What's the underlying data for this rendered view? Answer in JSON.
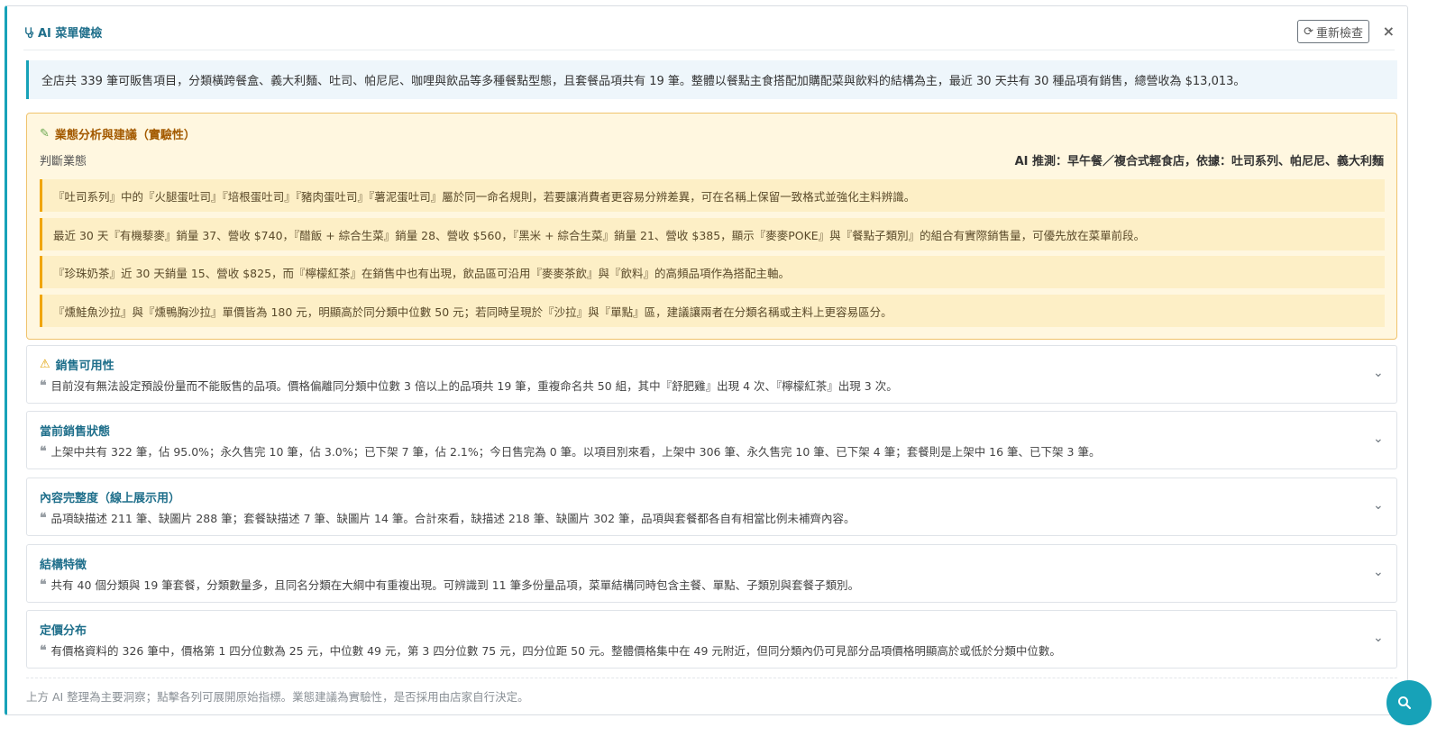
{
  "header": {
    "title": "AI 菜單健檢",
    "recheck_label": "重新檢查",
    "close_label": "×"
  },
  "summary": "全店共 339 筆可販售項目，分類橫跨餐盒、義大利麵、吐司、帕尼尼、咖哩與飲品等多種餐點型態，且套餐品項共有 19 筆。整體以餐點主食搭配加購配菜與飲料的結構為主，最近 30 天共有 30 種品項有銷售，總營收為 $13,013。",
  "business": {
    "title": "業態分析與建議（實驗性）",
    "judge_label": "判斷業態",
    "judge_value": "AI 推測：早午餐／複合式輕食店，依據：吐司系列、帕尼尼、義大利麵",
    "suggestions": [
      "『吐司系列』中的『火腿蛋吐司』『培根蛋吐司』『豬肉蛋吐司』『薯泥蛋吐司』屬於同一命名規則，若要讓消費者更容易分辨差異，可在名稱上保留一致格式並強化主料辨識。",
      "最近 30 天『有機藜麥』銷量 37、營收 $740，『醋飯 + 綜合生菜』銷量 28、營收 $560，『黑米 + 綜合生菜』銷量 21、營收 $385，顯示『麥麥POKE』與『餐點子類別』的組合有實際銷售量，可優先放在菜單前段。",
      "『珍珠奶茶』近 30 天銷量 15、營收 $825，而『檸檬紅茶』在銷售中也有出現，飲品區可沿用『麥麥茶飲』與『飲料』的高頻品項作為搭配主軸。",
      "『燻鮭魚沙拉』與『燻鴨胸沙拉』單價皆為 180 元，明顯高於同分類中位數 50 元；若同時呈現於『沙拉』與『單點』區，建議讓兩者在分類名稱或主料上更容易區分。"
    ]
  },
  "sections": [
    {
      "title": "銷售可用性",
      "icon": "warning-icon",
      "desc": "目前沒有無法設定預設份量而不能販售的品項。價格偏離同分類中位數 3 倍以上的品項共 19 筆，重複命名共 50 組，其中『舒肥雞』出現 4 次、『檸檬紅茶』出現 3 次。"
    },
    {
      "title": "當前銷售狀態",
      "desc": "上架中共有 322 筆，佔 95.0%；永久售完 10 筆，佔 3.0%；已下架 7 筆，佔 2.1%；今日售完為 0 筆。以項目別來看，上架中 306 筆、永久售完 10 筆、已下架 4 筆；套餐則是上架中 16 筆、已下架 3 筆。"
    },
    {
      "title": "內容完整度（線上展示用）",
      "desc": "品項缺描述 211 筆、缺圖片 288 筆；套餐缺描述 7 筆、缺圖片 14 筆。合計來看，缺描述 218 筆、缺圖片 302 筆，品項與套餐都各自有相當比例未補齊內容。"
    },
    {
      "title": "結構特徵",
      "desc": "共有 40 個分類與 19 筆套餐，分類數量多，且同名分類在大綱中有重複出現。可辨識到 11 筆多份量品項，菜單結構同時包含主餐、單點、子類別與套餐子類別。"
    },
    {
      "title": "定價分布",
      "desc": "有價格資料的 326 筆中，價格第 1 四分位數為 25 元，中位數 49 元，第 3 四分位數 75 元，四分位距 50 元。整體價格集中在 49 元附近，但同分類內仍可見部分品項價格明顯高於或低於分類中位數。"
    }
  ],
  "footer": "上方 AI 整理為主要洞察；點擊各列可展開原始指標。業態建議為實驗性，是否採用由店家自行決定。",
  "colors": {
    "accent": "#17a2b8",
    "title": "#1f6f8b",
    "warning_bg": "#fff7e0",
    "warning_border": "#f0c36d"
  }
}
